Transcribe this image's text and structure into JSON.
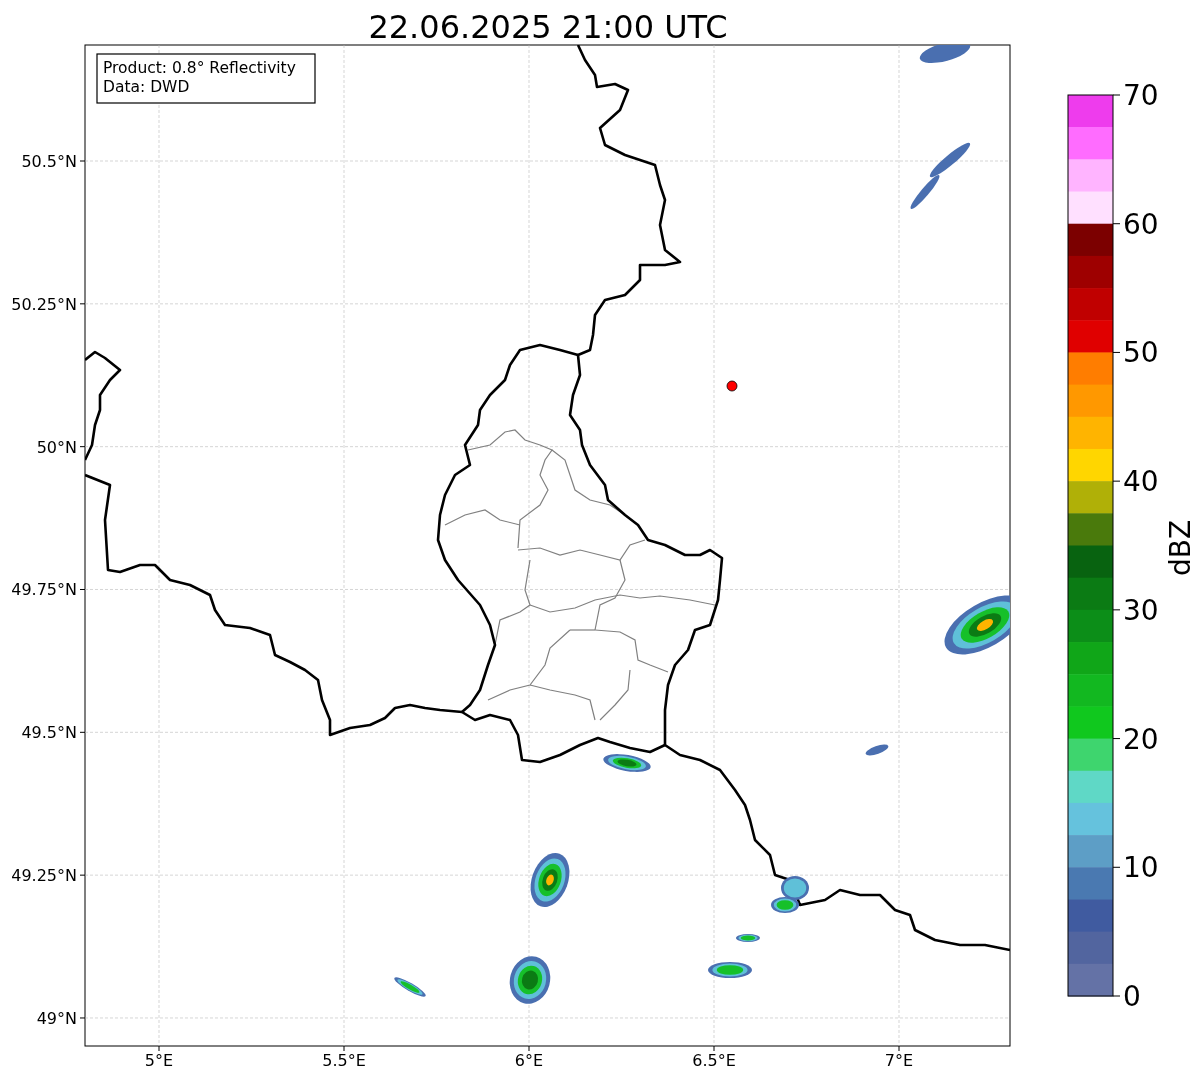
{
  "title": "22.06.2025 21:00 UTC",
  "info_box": [
    "Product: 0.8° Reflectivity",
    "Data: DWD"
  ],
  "y_ticks": [
    "50.5°N",
    "50.25°N",
    "50°N",
    "49.75°N",
    "49.5°N",
    "49.25°N",
    "49°N"
  ],
  "x_ticks": [
    "5°E",
    "5.5°E",
    "6°E",
    "6.5°E",
    "7°E"
  ],
  "colorbar": {
    "label": "dBZ",
    "ticks": [
      "70",
      "60",
      "50",
      "40",
      "30",
      "20",
      "10",
      "0"
    ],
    "colors": [
      {
        "color": "#ee3ced"
      },
      {
        "color": "#ff6cff"
      },
      {
        "color": "#ffb4ff"
      },
      {
        "color": "#ffe0ff"
      },
      {
        "color": "#7c0000"
      },
      {
        "color": "#9e0000"
      },
      {
        "color": "#c00000"
      },
      {
        "color": "#e00000"
      },
      {
        "color": "#ff7d00"
      },
      {
        "color": "#ff9800"
      },
      {
        "color": "#ffb400"
      },
      {
        "color": "#ffd600"
      },
      {
        "color": "#b0b007"
      },
      {
        "color": "#4a7a0c"
      },
      {
        "color": "#086310"
      },
      {
        "color": "#0b7b14"
      },
      {
        "color": "#0c8e18"
      },
      {
        "color": "#10a618"
      },
      {
        "color": "#12b820"
      },
      {
        "color": "#10c81e"
      },
      {
        "color": "#3ed56e"
      },
      {
        "color": "#5fd8c6"
      },
      {
        "color": "#65c2dd"
      },
      {
        "color": "#5d9ec6"
      },
      {
        "color": "#4a79b1"
      },
      {
        "color": "#405ba0"
      },
      {
        "color": "#52659f"
      },
      {
        "color": "#6472a6"
      }
    ]
  }
}
